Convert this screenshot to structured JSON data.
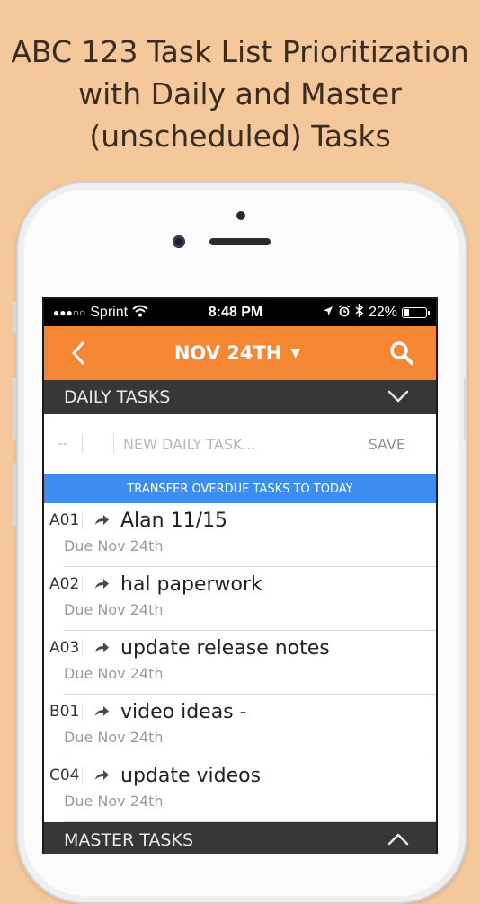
{
  "headline": {
    "line1": "ABC 123 Task List Prioritization",
    "line2": "with Daily and Master",
    "line3": "(unscheduled) Tasks"
  },
  "statusbar": {
    "signal": "●●●○○",
    "carrier": "Sprint",
    "time": "8:48 PM",
    "battery_percent": "22%",
    "battery_level": 0.22
  },
  "navbar": {
    "date_label": "NOV 24TH",
    "caret": "▼",
    "accent_color": "#f58634"
  },
  "daily_section": {
    "title": "DAILY TASKS"
  },
  "entry": {
    "priority_placeholder": "--",
    "task_placeholder": "NEW DAILY TASK...",
    "save_label": "SAVE"
  },
  "transfer": {
    "label": "TRANSFER OVERDUE TASKS TO TODAY",
    "color": "#3d8cf0"
  },
  "tasks": [
    {
      "code": "A01",
      "title": "Alan 11/15",
      "due": "Due Nov 24th"
    },
    {
      "code": "A02",
      "title": "hal paperwork",
      "due": "Due Nov 24th"
    },
    {
      "code": "A03",
      "title": "update release notes",
      "due": "Due Nov 24th"
    },
    {
      "code": "B01",
      "title": "video ideas -",
      "due": "Due Nov 24th"
    },
    {
      "code": "C04",
      "title": "update videos",
      "due": "Due Nov 24th"
    }
  ],
  "master_section": {
    "title": "MASTER TASKS"
  },
  "icons": {
    "back": "chevron-left-icon",
    "search": "search-icon",
    "daily_toggle": "chevron-down-icon",
    "master_toggle": "chevron-up-icon",
    "task_action": "forward-arrow-icon"
  }
}
